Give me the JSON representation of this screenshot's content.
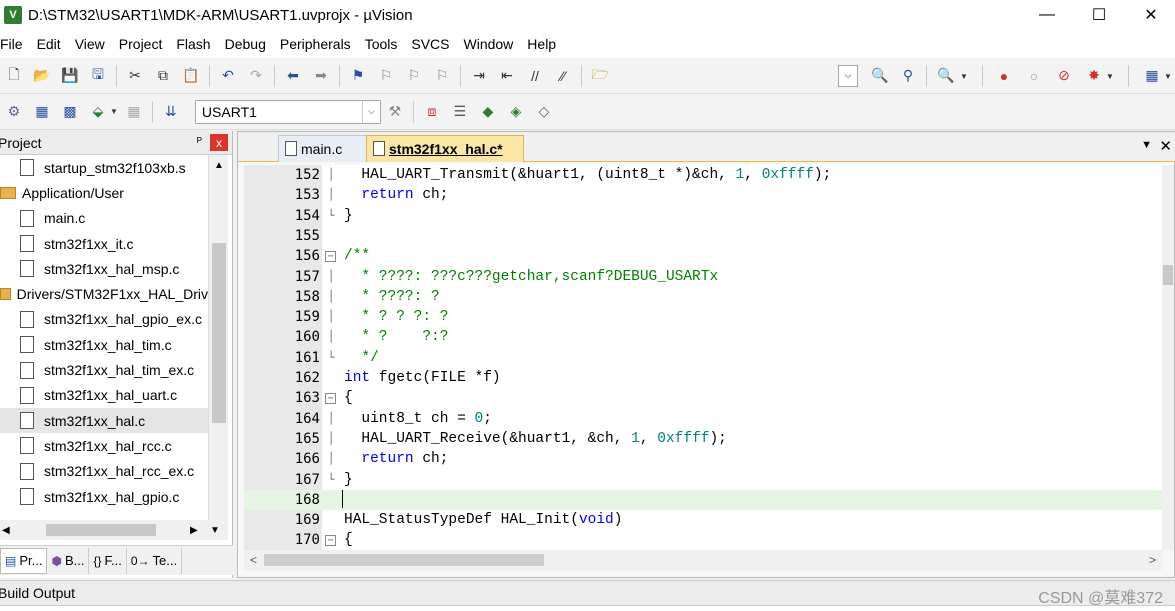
{
  "window": {
    "icon_label": "V",
    "title": "D:\\STM32\\USART1\\MDK-ARM\\USART1.uvprojx - µVision",
    "minimize": "—",
    "maximize": "☐",
    "close": "✕"
  },
  "menu": [
    "File",
    "Edit",
    "View",
    "Project",
    "Flash",
    "Debug",
    "Peripherals",
    "Tools",
    "SVCS",
    "Window",
    "Help"
  ],
  "toolbar2": {
    "target": "USART1",
    "dropdown_glyph": "⌵"
  },
  "project_panel": {
    "title": "Project",
    "pin": "ᴾ",
    "close": "x",
    "tree": [
      {
        "type": "file",
        "label": "startup_stm32f103xb.s"
      },
      {
        "type": "folder",
        "label": "Application/User"
      },
      {
        "type": "file",
        "label": "main.c"
      },
      {
        "type": "file",
        "label": "stm32f1xx_it.c"
      },
      {
        "type": "file",
        "label": "stm32f1xx_hal_msp.c"
      },
      {
        "type": "folder",
        "label": "Drivers/STM32F1xx_HAL_Driv"
      },
      {
        "type": "file",
        "label": "stm32f1xx_hal_gpio_ex.c"
      },
      {
        "type": "file",
        "label": "stm32f1xx_hal_tim.c"
      },
      {
        "type": "file",
        "label": "stm32f1xx_hal_tim_ex.c"
      },
      {
        "type": "file",
        "label": "stm32f1xx_hal_uart.c"
      },
      {
        "type": "file",
        "label": "stm32f1xx_hal.c",
        "selected": true
      },
      {
        "type": "file",
        "label": "stm32f1xx_hal_rcc.c"
      },
      {
        "type": "file",
        "label": "stm32f1xx_hal_rcc_ex.c"
      },
      {
        "type": "file",
        "label": "stm32f1xx_hal_gpio.c"
      }
    ],
    "tabs": [
      {
        "label": "Pr...",
        "icon": "▤"
      },
      {
        "label": "B...",
        "icon": "⬢"
      },
      {
        "label": "F...",
        "icon": "{}"
      },
      {
        "label": "Te...",
        "icon": "0→"
      }
    ]
  },
  "editor": {
    "tabs": [
      {
        "label": "main.c",
        "active": false
      },
      {
        "label": "stm32f1xx_hal.c*",
        "active": true
      }
    ],
    "tab_menu": "▼",
    "tab_close": "✕",
    "scroll_left": "<",
    "scroll_right": ">",
    "lines": [
      {
        "n": "152",
        "fold": "│",
        "html": "  HAL_UART_Transmit(&huart1, (uint8_t *)&ch, <span class=\"num\">1</span>, <span class=\"num\">0xffff</span>);"
      },
      {
        "n": "153",
        "fold": "│",
        "html": "  <span class=\"kw\">return</span> ch;"
      },
      {
        "n": "154",
        "fold": "└",
        "html": "}"
      },
      {
        "n": "155",
        "fold": "",
        "html": ""
      },
      {
        "n": "156",
        "fold": "box",
        "html": "<span class=\"cm\">/**</span>"
      },
      {
        "n": "157",
        "fold": "│",
        "html": "<span class=\"cm\">  * ????: ???c???getchar,scanf?DEBUG_USARTx</span>"
      },
      {
        "n": "158",
        "fold": "│",
        "html": "<span class=\"cm\">  * ????: ?</span>"
      },
      {
        "n": "159",
        "fold": "│",
        "html": "<span class=\"cm\">  * ? ? ?: ?</span>"
      },
      {
        "n": "160",
        "fold": "│",
        "html": "<span class=\"cm\">  * ?    ?:?</span>"
      },
      {
        "n": "161",
        "fold": "└",
        "html": "<span class=\"cm\">  */</span>"
      },
      {
        "n": "162",
        "fold": "",
        "html": "<span class=\"kw\">int</span> fgetc(FILE *f)"
      },
      {
        "n": "163",
        "fold": "box",
        "html": "{"
      },
      {
        "n": "164",
        "fold": "│",
        "html": "  uint8_t ch = <span class=\"num\">0</span>;"
      },
      {
        "n": "165",
        "fold": "│",
        "html": "  HAL_UART_Receive(&huart1, &ch, <span class=\"num\">1</span>, <span class=\"num\">0xffff</span>);"
      },
      {
        "n": "166",
        "fold": "│",
        "html": "  <span class=\"kw\">return</span> ch;"
      },
      {
        "n": "167",
        "fold": "└",
        "html": "}"
      },
      {
        "n": "168",
        "fold": "",
        "html": "",
        "current": true
      },
      {
        "n": "169",
        "fold": "",
        "html": "HAL_StatusTypeDef HAL_Init(<span class=\"kw\">void</span>)"
      },
      {
        "n": "170",
        "fold": "box",
        "html": "{"
      }
    ]
  },
  "build_output": {
    "title": "Build Output"
  },
  "watermark": "CSDN @莫难372"
}
